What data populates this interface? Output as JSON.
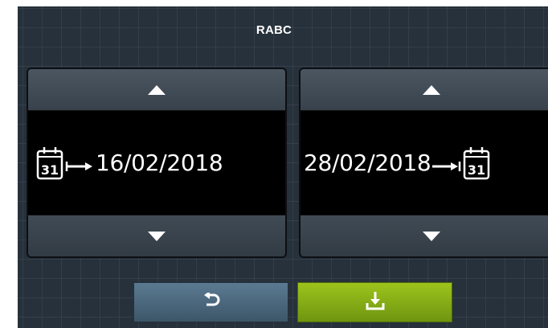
{
  "header": {
    "title": "RABC"
  },
  "start_date": {
    "value": "16/02/2018",
    "icon": "calendar-start-icon",
    "calendar_day": "31"
  },
  "end_date": {
    "value": "28/02/2018",
    "icon": "calendar-end-icon",
    "calendar_day": "31"
  },
  "colors": {
    "background": "#27313b",
    "back_button": "#4a6a82",
    "save_button": "#86ac16",
    "text": "#ffffff"
  }
}
